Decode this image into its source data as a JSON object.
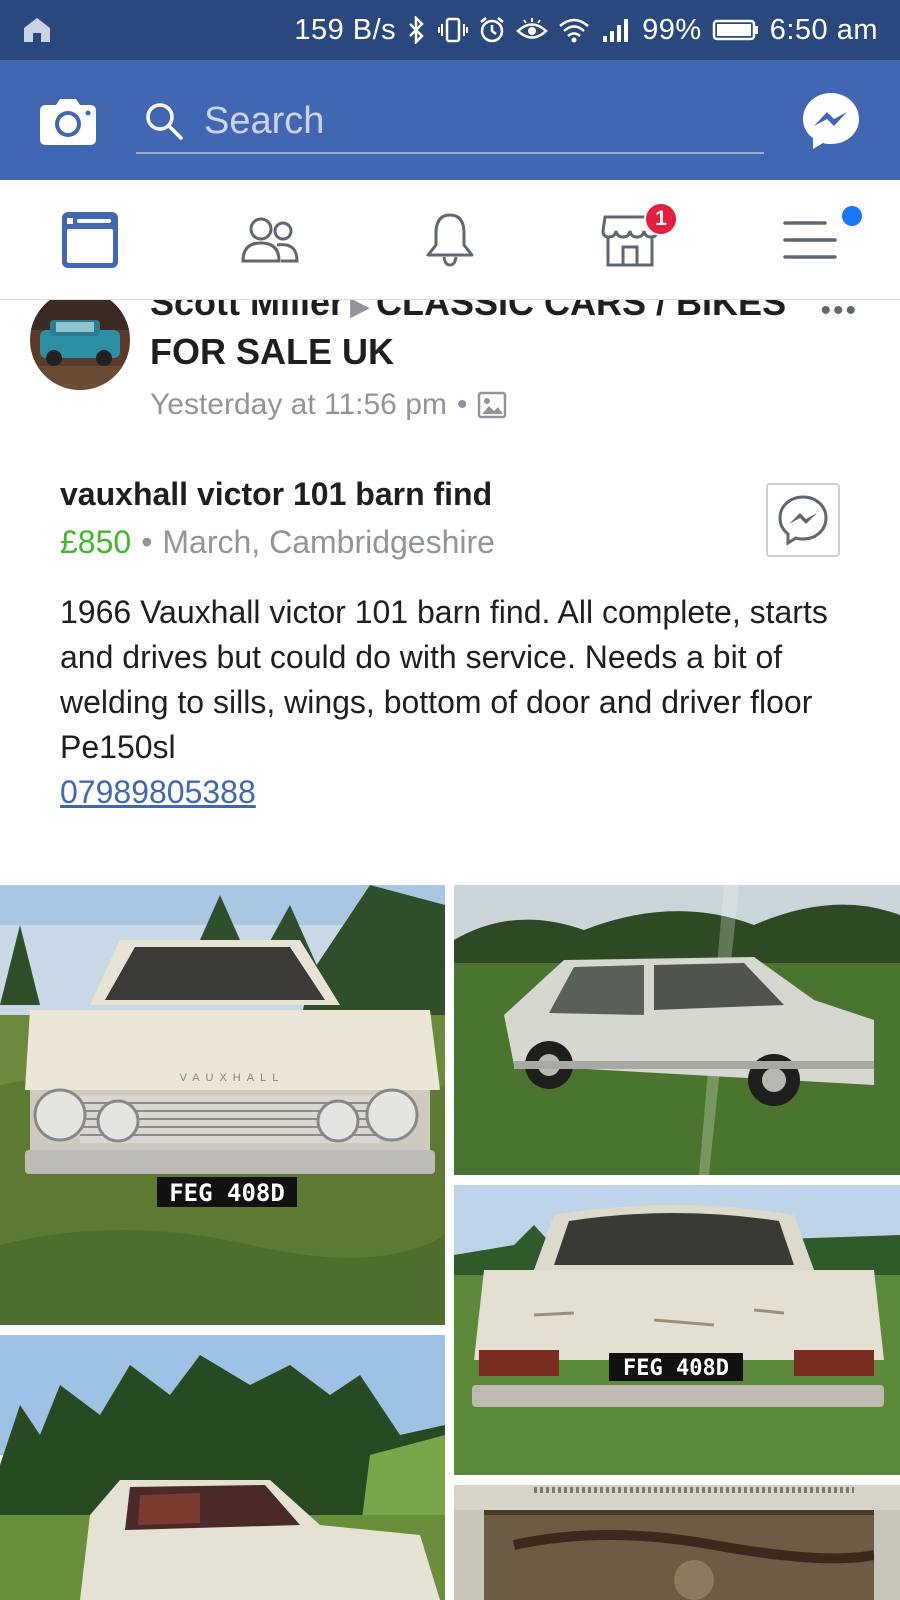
{
  "status_bar": {
    "net_speed": "159 B/s",
    "battery": "99%",
    "time": "6:50 am"
  },
  "header": {
    "search_placeholder": "Search"
  },
  "tabs": [
    {
      "name": "news-feed",
      "active": true
    },
    {
      "name": "friends"
    },
    {
      "name": "notifications"
    },
    {
      "name": "marketplace",
      "badge": "1"
    },
    {
      "name": "menu",
      "dot": true
    }
  ],
  "post": {
    "author": "Scott Miller",
    "group": "CLASSIC CARS / BIKES FOR SALE UK",
    "timestamp": "Yesterday at 11:56 pm",
    "dot": "•",
    "more": "•••"
  },
  "listing": {
    "title": "vauxhall victor 101 barn find",
    "price": "£850",
    "separator": "•",
    "location": "March, Cambridgeshire",
    "description_lines": [
      "1966 Vauxhall victor 101 barn find. All complete, starts and drives but could do with service. Needs a bit of welding to sills, wings, bottom of door and driver floor",
      "Pe150sl"
    ],
    "phone": "07989805388"
  },
  "photos": {
    "front_plate": "FEG 408D",
    "rear_plate": "FEG 408D",
    "grille_lettering": "VAUXHALL"
  },
  "colors": {
    "status_bar": "#29487d",
    "header": "#4267b2",
    "active_tab": "#4267b2",
    "price": "#42b72a",
    "badge": "#e41e3f"
  }
}
